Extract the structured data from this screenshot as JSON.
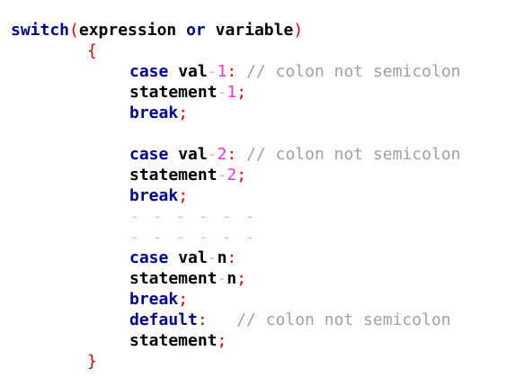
{
  "code": {
    "l1": {
      "kw": "switch",
      "open": "(",
      "a": "expression",
      "b": "or",
      "c": "variable",
      "close": ")"
    },
    "l2": {
      "brace": "{"
    },
    "l3": {
      "kw": "case",
      "val": "val",
      "dash": "-",
      "num": "1",
      "colon": ":",
      "comment": "// colon not semicolon"
    },
    "l4": {
      "id": "statement",
      "dash": "-",
      "num": "1",
      "semi": ";"
    },
    "l5": {
      "kw": "break",
      "semi": ";"
    },
    "l6": {
      "kw": "case",
      "val": "val",
      "dash": "-",
      "num": "2",
      "colon": ":",
      "comment": "// colon not semicolon"
    },
    "l7": {
      "id": "statement",
      "dash": "-",
      "num": "2",
      "semi": ";"
    },
    "l8": {
      "kw": "break",
      "semi": ";"
    },
    "l9": {
      "dashes": "- - - - - -"
    },
    "l10": {
      "dashes": "- - - - - -"
    },
    "l11": {
      "kw": "case",
      "val": "val",
      "dash": "-",
      "n": "n",
      "colon": ":"
    },
    "l12": {
      "id": "statement",
      "dash": "-",
      "n": "n",
      "semi": ";"
    },
    "l13": {
      "kw": "break",
      "semi": ";"
    },
    "l14": {
      "kw": "default",
      "colon": ":",
      "comment": "// colon not semicolon"
    },
    "l15": {
      "id": "statement",
      "semi": ";"
    },
    "l16": {
      "brace": "}"
    }
  }
}
